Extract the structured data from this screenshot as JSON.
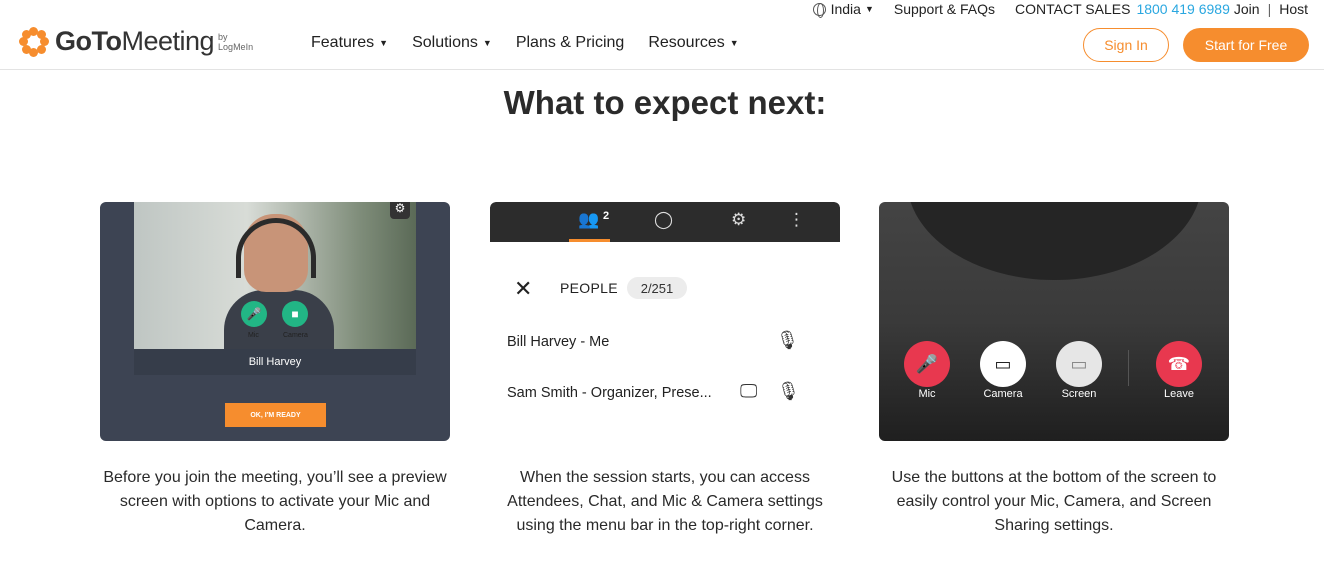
{
  "util": {
    "country": "India",
    "support": "Support & FAQs",
    "contact": "CONTACT SALES",
    "phone": "1800 419 6989",
    "join": "Join",
    "host": "Host"
  },
  "brand": {
    "name_bold": "GoTo",
    "name_light": "Meeting",
    "by": "by LogMeIn",
    "accent": "#f68d2e"
  },
  "nav": {
    "items": [
      "Features",
      "Solutions",
      "Plans & Pricing",
      "Resources"
    ],
    "sign_in": "Sign In",
    "start": "Start for Free"
  },
  "heading": "What to expect next:",
  "card1": {
    "mic": "Mic",
    "camera": "Camera",
    "name": "Bill Harvey",
    "ready": "OK, I'M READY"
  },
  "card2": {
    "tab_badge": "2",
    "people_title": "PEOPLE",
    "people_count": "2/251",
    "rows": [
      "Bill Harvey - Me",
      "Sam Smith - Organizer, Prese..."
    ]
  },
  "card3": {
    "buttons": [
      "Mic",
      "Camera",
      "Screen",
      "Leave"
    ]
  },
  "descriptions": [
    "Before you join the meeting, you’ll see a preview screen with options to activate your Mic and Camera.",
    "When the session starts, you can access Attendees, Chat, and Mic & Camera settings using the menu bar in the top-right corner.",
    "Use the buttons at the bottom of the screen to easily control your Mic, Camera, and Screen Sharing settings."
  ]
}
